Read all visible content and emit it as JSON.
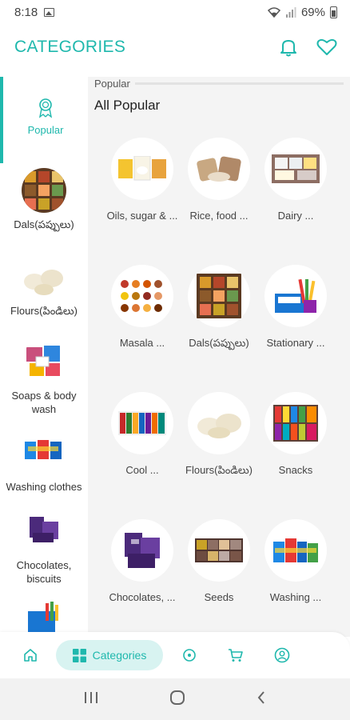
{
  "status_bar": {
    "time": "8:18",
    "battery": "69%"
  },
  "header": {
    "title": "CATEGORIES"
  },
  "colors": {
    "accent": "#1fb8ad",
    "accent_light": "#d8f3f1",
    "main_bg": "#f4f4f4"
  },
  "sidebar": {
    "items": [
      {
        "label": "Popular",
        "icon": "popular-badge-icon"
      },
      {
        "label": "Dals(పప్పులు)",
        "icon": "dals-thumbnail"
      },
      {
        "label": "Flours(పిండిలు)",
        "icon": "flours-thumbnail"
      },
      {
        "label": "Soaps & body wash",
        "icon": "soaps-thumbnail"
      },
      {
        "label": "Washing clothes",
        "icon": "washing-thumbnail"
      },
      {
        "label": "Chocolates, biscuits",
        "icon": "chocolates-thumbnail"
      }
    ]
  },
  "main": {
    "section_small": "Popular",
    "section_title": "All Popular",
    "items": [
      {
        "label": "Oils, sugar & ...",
        "icon": "oils-thumbnail"
      },
      {
        "label": "Rice, food ...",
        "icon": "rice-thumbnail"
      },
      {
        "label": "Dairy ...",
        "icon": "dairy-thumbnail"
      },
      {
        "label": "Masala ...",
        "icon": "masala-thumbnail"
      },
      {
        "label": "Dals(పప్పులు)",
        "icon": "dals-thumbnail"
      },
      {
        "label": "Stationary ...",
        "icon": "stationary-thumbnail"
      },
      {
        "label": "Cool ...",
        "icon": "cool-drinks-thumbnail"
      },
      {
        "label": "Flours(పిండిలు)",
        "icon": "flours-thumbnail"
      },
      {
        "label": "Snacks",
        "icon": "snacks-thumbnail"
      },
      {
        "label": "Chocolates, ...",
        "icon": "chocolates-thumbnail"
      },
      {
        "label": "Seeds",
        "icon": "seeds-thumbnail"
      },
      {
        "label": "Washing ...",
        "icon": "washing-thumbnail"
      }
    ]
  },
  "bottom_nav": {
    "categories_label": "Categories",
    "items": [
      "home-icon",
      "categories-icon",
      "orders-icon",
      "cart-icon",
      "profile-icon"
    ]
  }
}
